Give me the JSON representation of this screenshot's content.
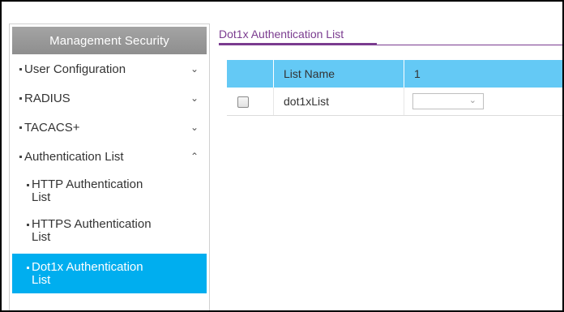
{
  "sidebar": {
    "header": "Management Security",
    "items": [
      {
        "label": "User Configuration",
        "chevron": "chevron-down"
      },
      {
        "label": "RADIUS",
        "chevron": "chevron-down"
      },
      {
        "label": "TACACS+",
        "chevron": "chevron-down"
      },
      {
        "label": "Authentication List",
        "chevron": "chevron-up"
      }
    ],
    "sub_items": [
      {
        "line1": "HTTP Authentication",
        "line2": "List"
      },
      {
        "line1": "HTTPS Authentication",
        "line2": "List"
      },
      {
        "line1": "Dot1x Authentication",
        "line2": "List",
        "active": true
      }
    ],
    "chevron_down_glyph": "⌄",
    "chevron_up_glyph": "⌃"
  },
  "main": {
    "title": "Dot1x Authentication List",
    "table": {
      "headers": [
        "",
        "List Name",
        "1"
      ],
      "rows": [
        {
          "checked": false,
          "name": "dot1xList",
          "select_value": ""
        }
      ]
    }
  },
  "colors": {
    "accent_purple": "#7a3b8f",
    "header_blue": "#64c9f5",
    "active_blue": "#00aeef",
    "sidebar_header_gray": "#9a9a9a"
  },
  "icons": {
    "select_arrow": "⌄"
  }
}
